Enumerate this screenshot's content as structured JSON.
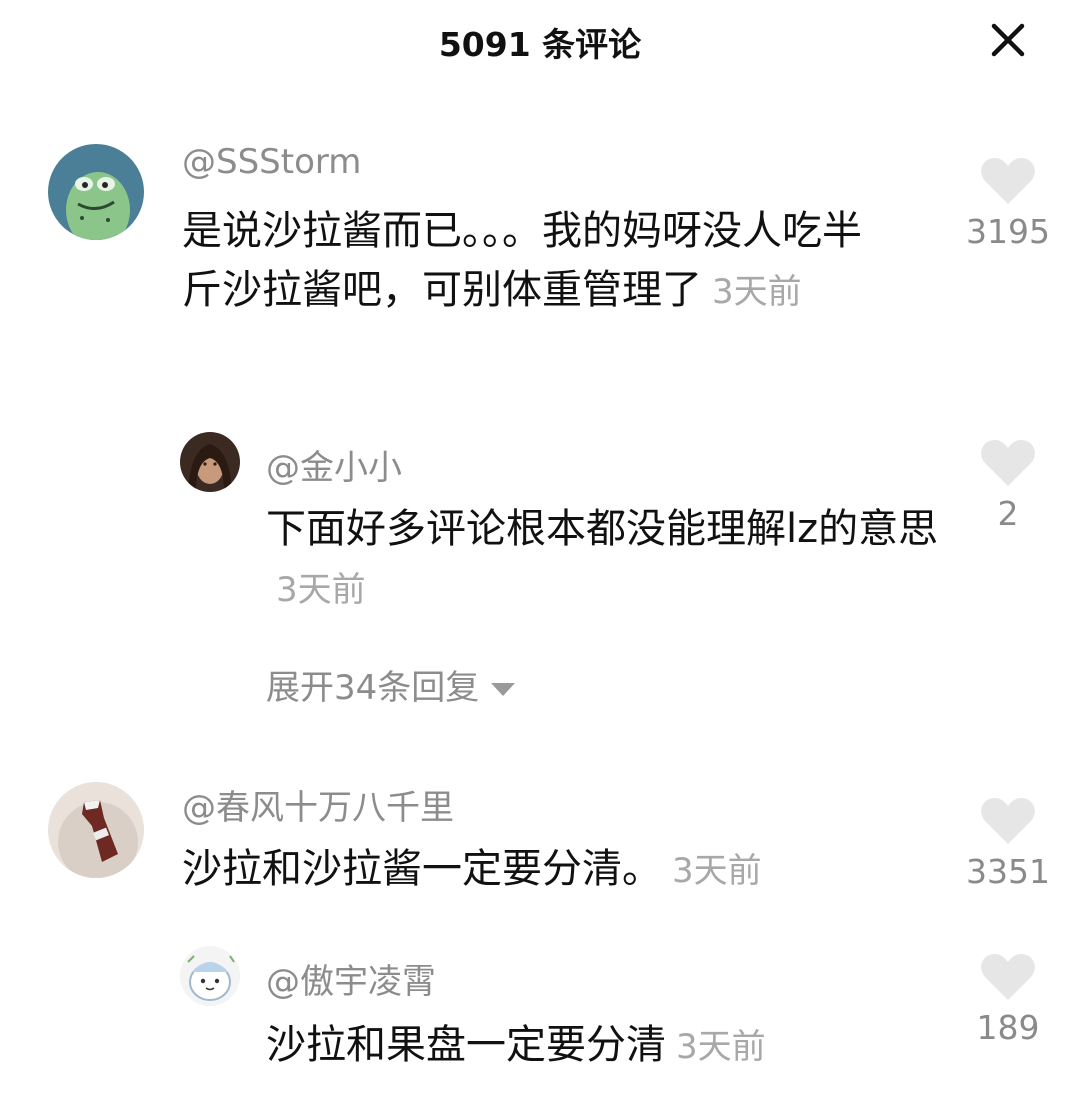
{
  "header": {
    "title": "5091 条评论"
  },
  "comments": [
    {
      "username": "@SSStorm",
      "text": "是说沙拉酱而已。。。我的妈呀没人吃半斤沙拉酱吧，可别体重管理了",
      "time": "3天前",
      "likes": "3195",
      "avatar_icon": "green-frog-avatar"
    },
    {
      "username": "@金小小",
      "text": "下面好多评论根本都没能理解lz的意思",
      "time": "3天前",
      "likes": "2",
      "avatar_icon": "woman-portrait-avatar"
    },
    {
      "username": "@春风十万八千里",
      "text": "沙拉和沙拉酱一定要分清。",
      "time": "3天前",
      "likes": "3351",
      "avatar_icon": "cola-bottle-avatar"
    },
    {
      "username": "@傲宇凌霄",
      "text": "沙拉和果盘一定要分清",
      "time": "3天前",
      "likes": "189",
      "avatar_icon": "cartoon-character-avatar"
    }
  ],
  "replies_toggle": {
    "label": "展开34条回复",
    "icon": "caret-down-icon"
  },
  "colors": {
    "heart": "#e6e6e6",
    "username": "#8c8c8c",
    "time": "#a8a8a8"
  }
}
